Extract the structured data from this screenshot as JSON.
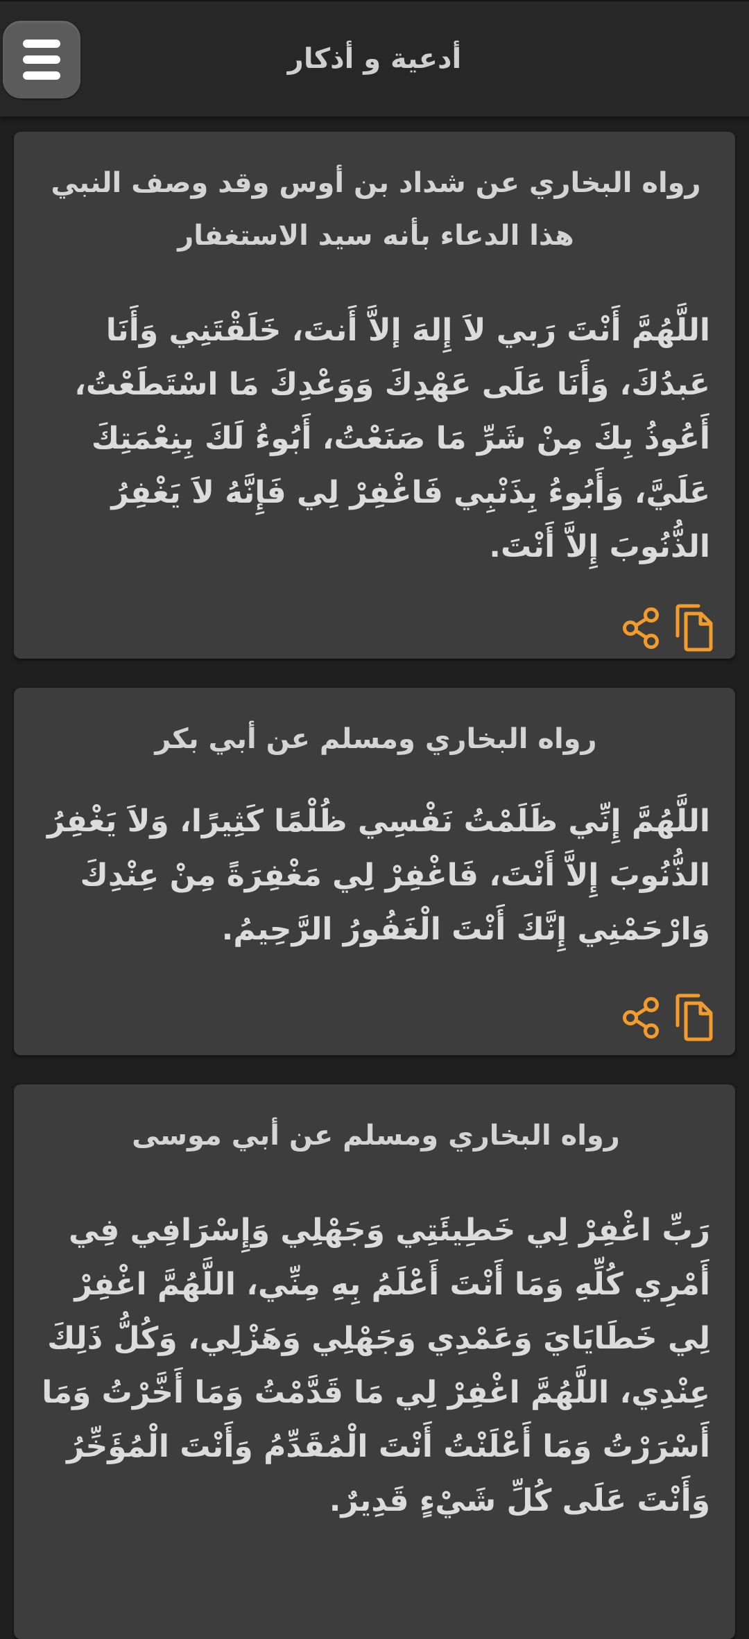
{
  "app": {
    "title": "أدعية و أذكار"
  },
  "header": {
    "menu_icon": "hamburger-menu-icon"
  },
  "colors": {
    "background": "#1e1e1e",
    "app_bar": "#272727",
    "card": "#3d3d3d",
    "text": "#dcdcdc",
    "accent": "#f39c2c",
    "menu_button": "#5b5b5b"
  },
  "cards": [
    {
      "source": "رواه البخاري عن شداد بن أوس وقد وصف النبي هذا الدعاء بأنه سيد الاستغفار",
      "text": "اللَّهُمَّ أَنْتَ رَبي لاَ إِلهَ إلاَّ أَنتَ، خَلَقْتَنِي وَأَنَا عَبدُكَ، وَأَنَا عَلَى عَهْدِكَ وَوَعْدِكَ مَا اسْتَطَعْتُ، أَعُوذُ بِكَ مِنْ شَرِّ مَا صَنَعْتُ، أَبُوءُ لَكَ بِنِعْمَتِكَ عَلَيَّ، وَأَبُوءُ بِذَنْبِي فَاغْفِرْ لِي فَإِنَّهُ لاَ يَغْفِرُ الذُّنُوبَ إِلاَّ أَنْتَ.",
      "share_icon": "share-icon",
      "copy_icon": "copy-icon"
    },
    {
      "source": "رواه البخاري ومسلم عن أبي بكر",
      "text": "اللَّهُمَّ إِنِّي ظَلَمْتُ نَفْسِي ظُلْمًا كَثِيرًا، وَلاَ يَغْفِرُ الذُّنُوبَ إِلاَّ أَنْتَ، فَاغْفِرْ لِي مَغْفِرَةً مِنْ عِنْدِكَ وَارْحَمْنِي إِنَّكَ أَنْتَ الْغَفُورُ الرَّحِيمُ.",
      "share_icon": "share-icon",
      "copy_icon": "copy-icon"
    },
    {
      "source": "رواه البخاري ومسلم عن أبي موسى",
      "text": "رَبِّ اغْفِرْ لِي خَطِيئَتِي وَجَهْلِي وَإِسْرَافِي فِي أَمْرِي كُلِّهِ وَمَا أَنْتَ أَعْلَمُ بِهِ مِنِّي، اللَّهُمَّ اغْفِرْ لِي خَطَايَايَ وَعَمْدِي وَجَهْلِي وَهَزْلِي، وَكُلُّ ذَلِكَ عِنْدِي، اللَّهُمَّ اغْفِرْ لِي مَا قَدَّمْتُ وَمَا أَخَّرْتُ وَمَا أَسْرَرْتُ وَمَا أَعْلَنْتُ أَنْتَ الْمُقَدِّمُ وَأَنْتَ الْمُؤَخِّرُ وَأَنْتَ عَلَى كُلِّ شَيْءٍ قَدِيرٌ."
    }
  ]
}
